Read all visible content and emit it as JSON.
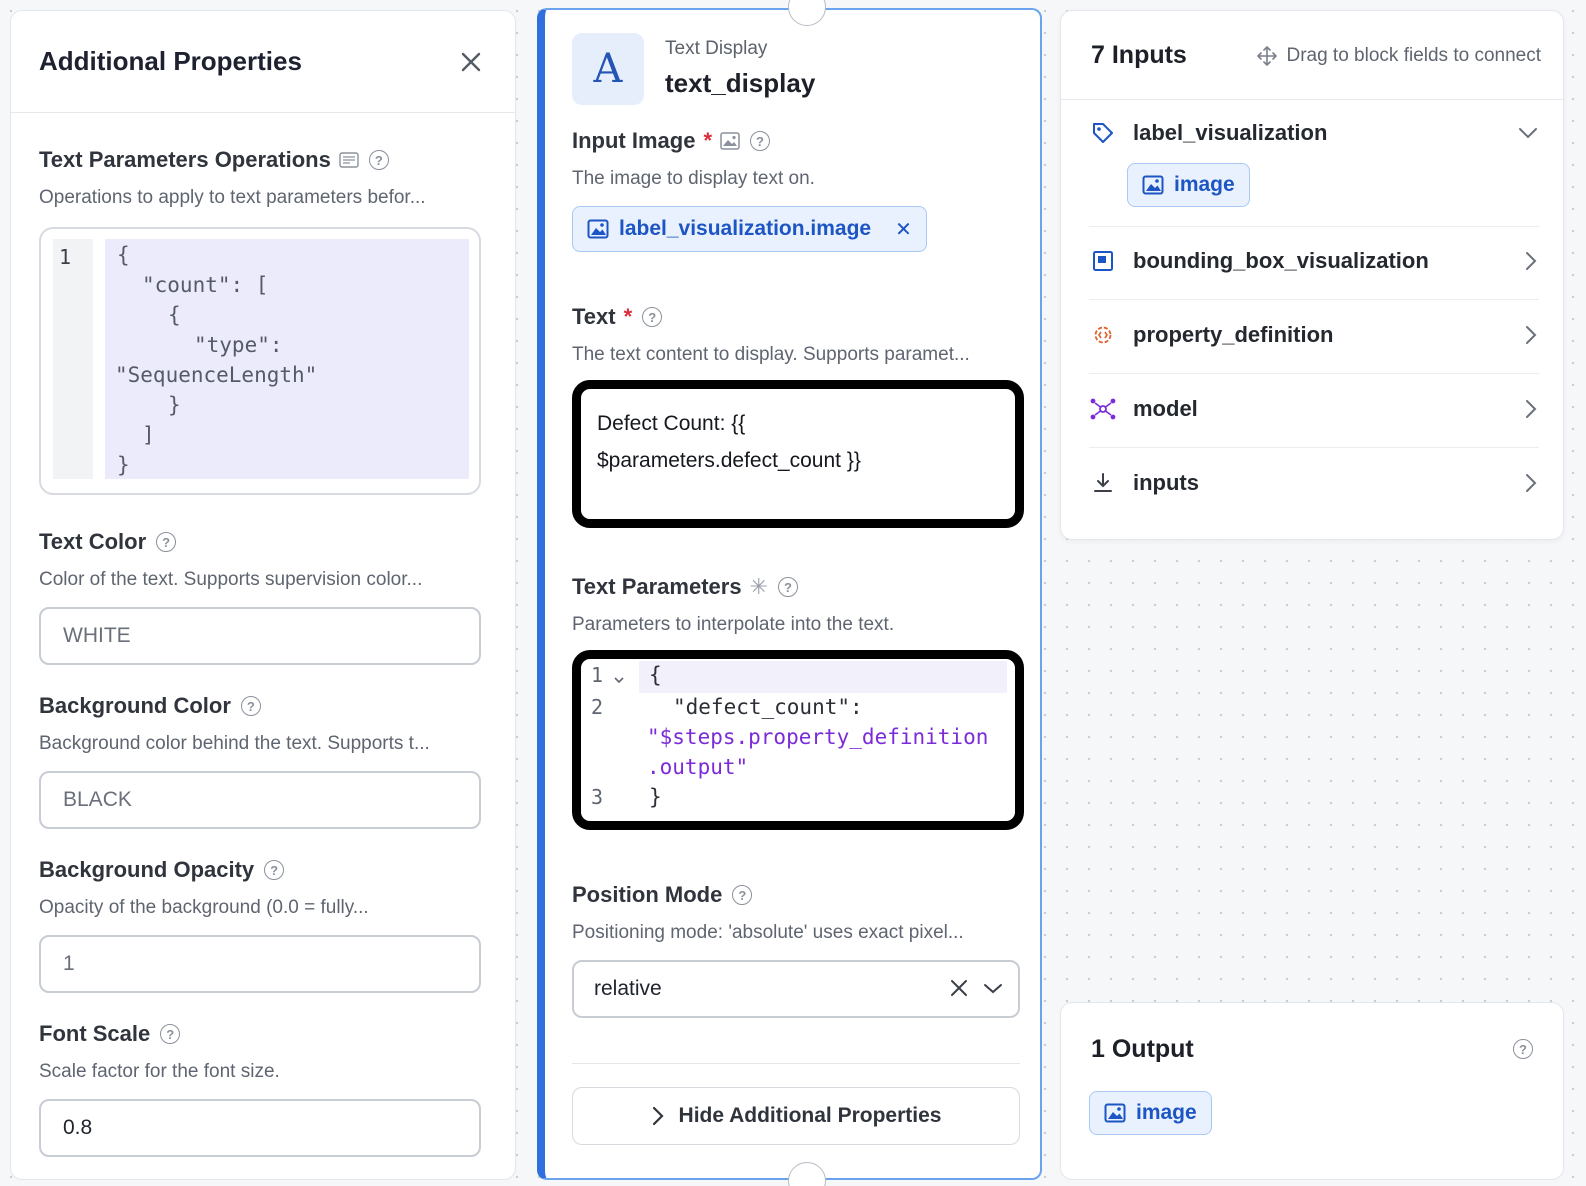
{
  "left_panel": {
    "title": "Additional Properties",
    "fields": {
      "text_params_ops": {
        "label": "Text Parameters Operations",
        "description": "Operations to apply to text parameters befor...",
        "line_number": "1",
        "code_lines": [
          "{",
          "\"count\": [",
          "{",
          "\"type\":",
          "\"SequenceLength\"",
          "}",
          "]",
          "}"
        ]
      },
      "text_color": {
        "label": "Text Color",
        "description": "Color of the text. Supports supervision color...",
        "placeholder": "WHITE"
      },
      "background_color": {
        "label": "Background Color",
        "description": "Background color behind the text. Supports t...",
        "placeholder": "BLACK"
      },
      "background_opacity": {
        "label": "Background Opacity",
        "description": "Opacity of the background (0.0 = fully...",
        "placeholder": "1"
      },
      "font_scale": {
        "label": "Font Scale",
        "description": "Scale factor for the font size.",
        "value": "0.8"
      }
    }
  },
  "block": {
    "icon_letter": "A",
    "kind": "Text Display",
    "name": "text_display",
    "input_image": {
      "label": "Input Image",
      "required_mark": "*",
      "description": "The image to display text on.",
      "chip": "label_visualization.image"
    },
    "text": {
      "label": "Text",
      "required_mark": "*",
      "description": "The text content to display. Supports paramet...",
      "value_line1": "Defect Count: {{",
      "value_line2": "$parameters.defect_count }}"
    },
    "text_parameters": {
      "label": "Text Parameters",
      "optional_mark": "✳",
      "description": "Parameters to interpolate into the text.",
      "line_numbers": [
        "1",
        "2",
        "3"
      ],
      "code": {
        "open": "{",
        "key": "\"defect_count\":",
        "value_part1": "\"$steps.property_definition",
        "value_part2": ".output\"",
        "close": "}"
      }
    },
    "position_mode": {
      "label": "Position Mode",
      "description": "Positioning mode: 'absolute' uses exact pixel...",
      "selected": "relative"
    },
    "hide_button": "Hide Additional Properties"
  },
  "inputs_panel": {
    "title": "7 Inputs",
    "drag_hint": "Drag to block fields to connect",
    "items": [
      {
        "label": "label_visualization",
        "icon": "tag-icon",
        "expanded": true,
        "chip": "image"
      },
      {
        "label": "bounding_box_visualization",
        "icon": "bounding-box-icon"
      },
      {
        "label": "property_definition",
        "icon": "gear-code-icon"
      },
      {
        "label": "model",
        "icon": "model-graph-icon"
      },
      {
        "label": "inputs",
        "icon": "download-icon"
      }
    ]
  },
  "output_panel": {
    "title": "1 Output",
    "chip": "image"
  },
  "colors": {
    "accent_blue": "#2f6fde",
    "chip_bg": "#e8f1fd",
    "required_red": "#d92d3a",
    "code_purple": "#7b2bd8"
  }
}
